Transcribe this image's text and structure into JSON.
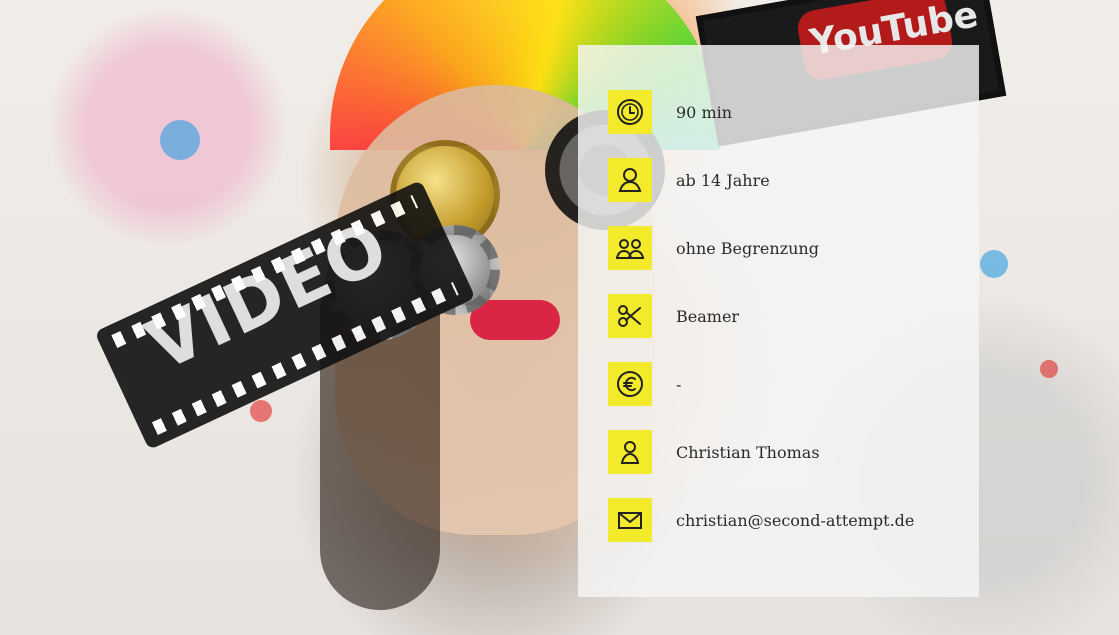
{
  "background": {
    "decorative_text": {
      "video": "VIDEO",
      "youtube": "YouTube"
    }
  },
  "info_panel": {
    "items": [
      {
        "icon": "clock-icon",
        "label": "90 min"
      },
      {
        "icon": "person-icon",
        "label": "ab 14 Jahre"
      },
      {
        "icon": "group-icon",
        "label": "ohne Begrenzung"
      },
      {
        "icon": "scissors-icon",
        "label": "Beamer"
      },
      {
        "icon": "euro-icon",
        "label": "-"
      },
      {
        "icon": "person-outline-icon",
        "label": "Christian Thomas"
      },
      {
        "icon": "envelope-icon",
        "label": "christian@second-attempt.de"
      }
    ]
  },
  "colors": {
    "icon_background": "#f2ea2a",
    "panel_background": "rgba(245,245,245,0.82)",
    "text": "#2a2a2a"
  }
}
